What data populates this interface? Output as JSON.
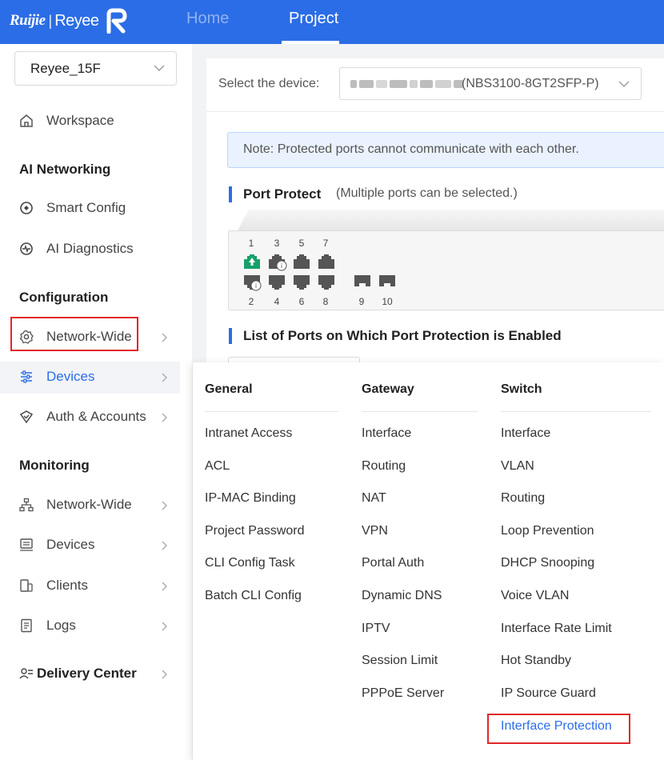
{
  "header": {
    "logo_brand": "Ruijie",
    "logo_sep": "|",
    "logo_brand2": "Reyee",
    "tabs": [
      "Home",
      "Project"
    ],
    "active_tab": "Project",
    "bg_color": "#2b6de6"
  },
  "sidebar": {
    "project_select": "Reyee_15F",
    "workspace": "Workspace",
    "sections": {
      "ai_networking": "AI Networking",
      "configuration": "Configuration",
      "monitoring": "Monitoring",
      "delivery_center": "Delivery Center"
    },
    "items": {
      "smart_config": "Smart Config",
      "ai_diagnostics": "AI Diagnostics",
      "cfg_network_wide": "Network-Wide",
      "cfg_devices": "Devices",
      "auth_accounts": "Auth & Accounts",
      "mon_network_wide": "Network-Wide",
      "mon_devices": "Devices",
      "clients": "Clients",
      "logs": "Logs"
    },
    "highlighted_item": "Devices"
  },
  "main": {
    "device_label": "Select the device:",
    "device_value": "(NBS3100-8GT2SFP-P)",
    "note": "Note: Protected ports cannot communicate with each other.",
    "port_protect_title": "Port Protect",
    "port_protect_sub": "(Multiple ports can be selected.)",
    "ports_top": [
      "1",
      "3",
      "5",
      "7"
    ],
    "ports_bottom": [
      "2",
      "4",
      "6",
      "8",
      "9",
      "10"
    ],
    "list_title": "List of Ports on Which Port Protection is Enabled"
  },
  "menu": {
    "general": {
      "title": "General",
      "items": [
        "Intranet Access",
        "ACL",
        "IP-MAC Binding",
        "Project Password",
        "CLI Config Task",
        "Batch CLI Config"
      ]
    },
    "gateway": {
      "title": "Gateway",
      "items": [
        "Interface",
        "Routing",
        "NAT",
        "VPN",
        "Portal Auth",
        "Dynamic DNS",
        "IPTV",
        "Session Limit",
        "PPPoE Server"
      ]
    },
    "switch": {
      "title": "Switch",
      "items": [
        "Interface",
        "VLAN",
        "Routing",
        "Loop Prevention",
        "DHCP Snooping",
        "Voice VLAN",
        "Interface Rate Limit",
        "Hot Standby",
        "IP Source Guard",
        "Interface Protection"
      ]
    },
    "highlighted_item": "Interface Protection"
  },
  "colors": {
    "accent": "#2b6de6",
    "highlight_box": "#e0262b",
    "port_up": "#16a06a",
    "port_down": "#555555"
  }
}
